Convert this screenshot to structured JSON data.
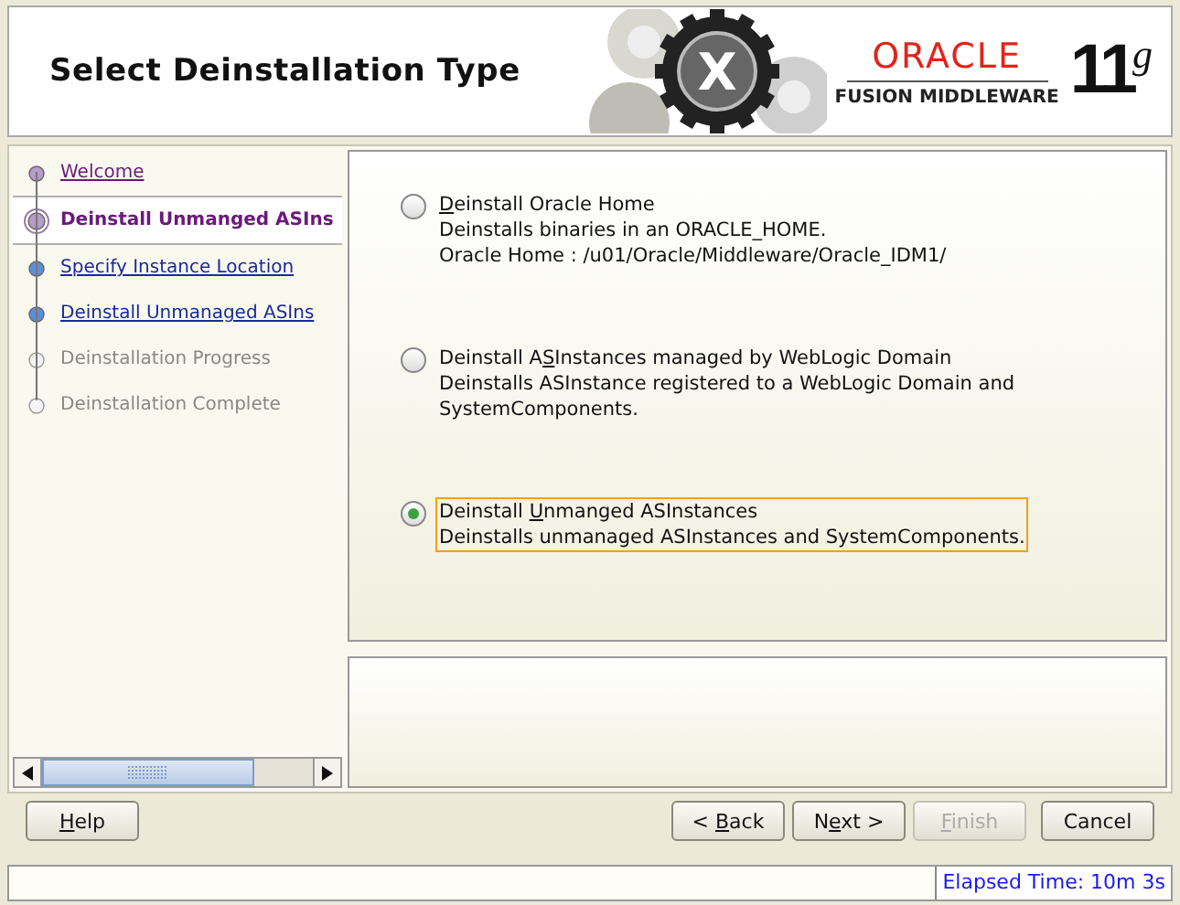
{
  "header": {
    "title": "Select Deinstallation Type",
    "logo_mark": "X",
    "brand": "ORACLE",
    "product": "FUSION MIDDLEWARE",
    "version": "11",
    "version_sup": "g"
  },
  "steps": [
    {
      "label": "Welcome",
      "kind": "done",
      "selected": false
    },
    {
      "label": "Deinstall Unmanged ASIns",
      "kind": "current",
      "selected": true
    },
    {
      "label": "Specify Instance Location",
      "kind": "link",
      "selected": false
    },
    {
      "label": "Deinstall Unmanaged ASIns",
      "kind": "link",
      "selected": false
    },
    {
      "label": "Deinstallation Progress",
      "kind": "pending",
      "selected": false
    },
    {
      "label": "Deinstallation Complete",
      "kind": "pending",
      "selected": false
    }
  ],
  "options": [
    {
      "label": {
        "key": "D",
        "post": "einstall Oracle Home"
      },
      "lines": [
        "Deinstalls binaries in an ORACLE_HOME.",
        "Oracle Home : /u01/Oracle/Middleware/Oracle_IDM1/"
      ],
      "selected": false
    },
    {
      "label": {
        "pre": "Deinstall A",
        "key": "S",
        "post": "Instances managed by WebLogic Domain"
      },
      "lines": [
        "Deinstalls ASInstance registered to a WebLogic Domain and",
        "SystemComponents."
      ],
      "selected": false
    },
    {
      "label": {
        "pre": "Deinstall ",
        "key": "U",
        "post": "nmanged ASInstances"
      },
      "lines": [
        "Deinstalls unmanaged ASInstances and SystemComponents."
      ],
      "selected": true
    }
  ],
  "buttons": [
    {
      "label": {
        "key": "H",
        "post": "elp"
      },
      "kind": "help",
      "disabled": false
    },
    {
      "label": {
        "pre": "< ",
        "key": "B",
        "post": "ack"
      },
      "kind": "nav",
      "disabled": false
    },
    {
      "label": {
        "pre": "N",
        "key": "e",
        "post": "xt >"
      },
      "kind": "nav",
      "disabled": false
    },
    {
      "label": {
        "key": "F",
        "post": "inish"
      },
      "kind": "nav",
      "disabled": true
    },
    {
      "label": {
        "post": "Cancel"
      },
      "kind": "cancel",
      "disabled": false
    }
  ],
  "status_bar": {
    "elapsed": "Elapsed Time: 10m 3s"
  }
}
